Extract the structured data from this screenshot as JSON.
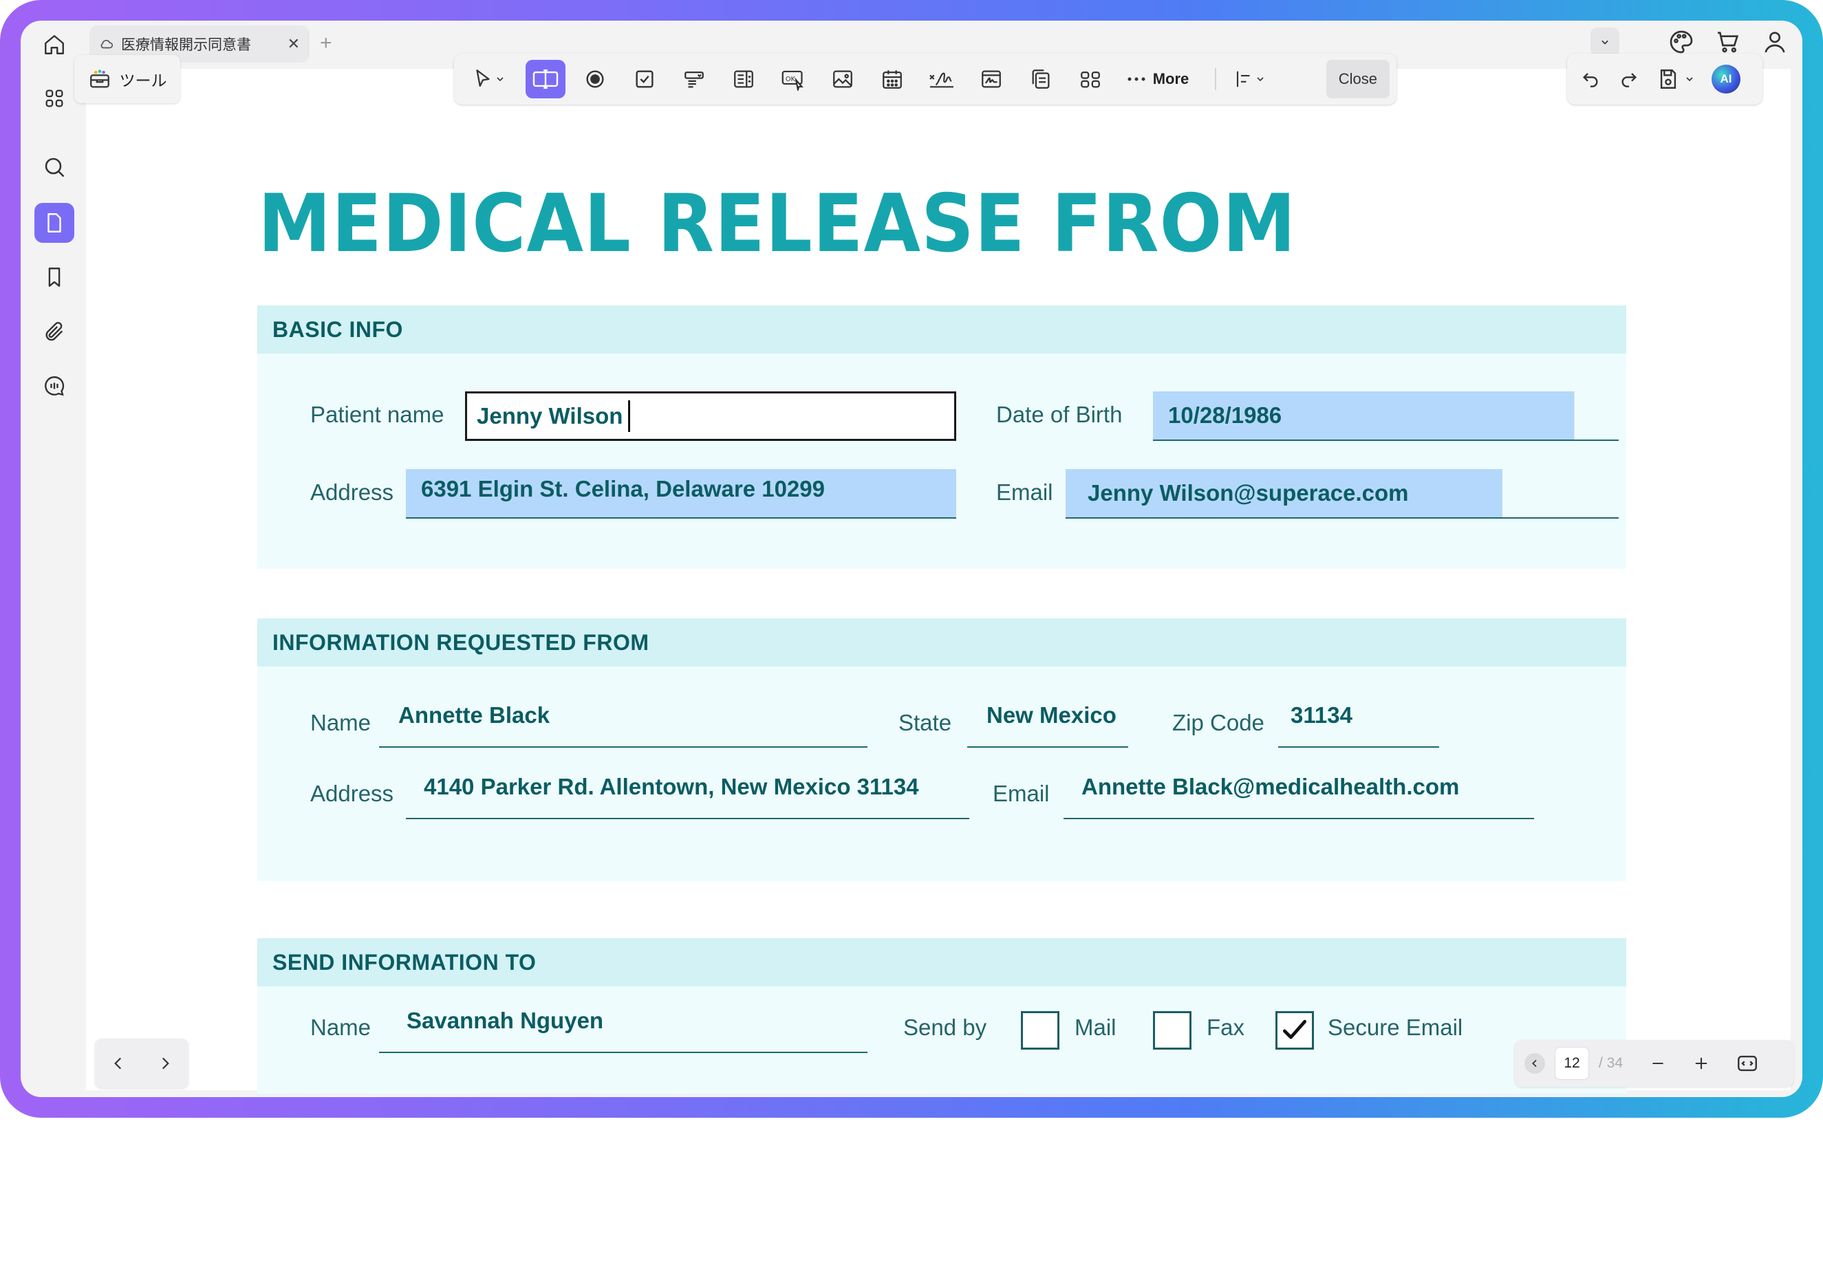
{
  "tab": {
    "title": "医療情報開示同意書"
  },
  "tools": {
    "label": "ツール"
  },
  "form_toolbar": {
    "more_label": "More",
    "close_label": "Close",
    "ok_icon_text": "OK"
  },
  "ai": {
    "label": "AI"
  },
  "document": {
    "title": "MEDICAL RELEASE FROM",
    "basic_info": {
      "heading": "BASIC INFO",
      "patient_name_label": "Patient name",
      "patient_name_value": "Jenny Wilson",
      "dob_label": "Date of Birth",
      "dob_value": "10/28/1986",
      "address_label": "Address",
      "address_value": "6391 Elgin St. Celina, Delaware 10299",
      "email_label": "Email",
      "email_value": "Jenny Wilson@superace.com"
    },
    "requested_from": {
      "heading": "INFORMATION REQUESTED FROM",
      "name_label": "Name",
      "name_value": "Annette Black",
      "state_label": "State",
      "state_value": "New Mexico",
      "zip_label": "Zip Code",
      "zip_value": "31134",
      "address_label": "Address",
      "address_value": "4140 Parker Rd. Allentown, New Mexico 31134",
      "email_label": "Email",
      "email_value": "Annette Black@medicalhealth.com"
    },
    "send_to": {
      "heading": "SEND INFORMATION TO",
      "name_label": "Name",
      "name_value": "Savannah Nguyen",
      "send_by_label": "Send by",
      "options": [
        {
          "label": "Mail",
          "checked": false
        },
        {
          "label": "Fax",
          "checked": false
        },
        {
          "label": "Secure Email",
          "checked": true
        }
      ]
    }
  },
  "pagination": {
    "current": "12",
    "total": "/ 34"
  },
  "colors": {
    "title": "#17a5ad",
    "section_header_bg": "#d2f2f5",
    "section_bg": "#effcfd",
    "field_highlight": "#b4d8fb",
    "accent": "#7b6cf6"
  }
}
